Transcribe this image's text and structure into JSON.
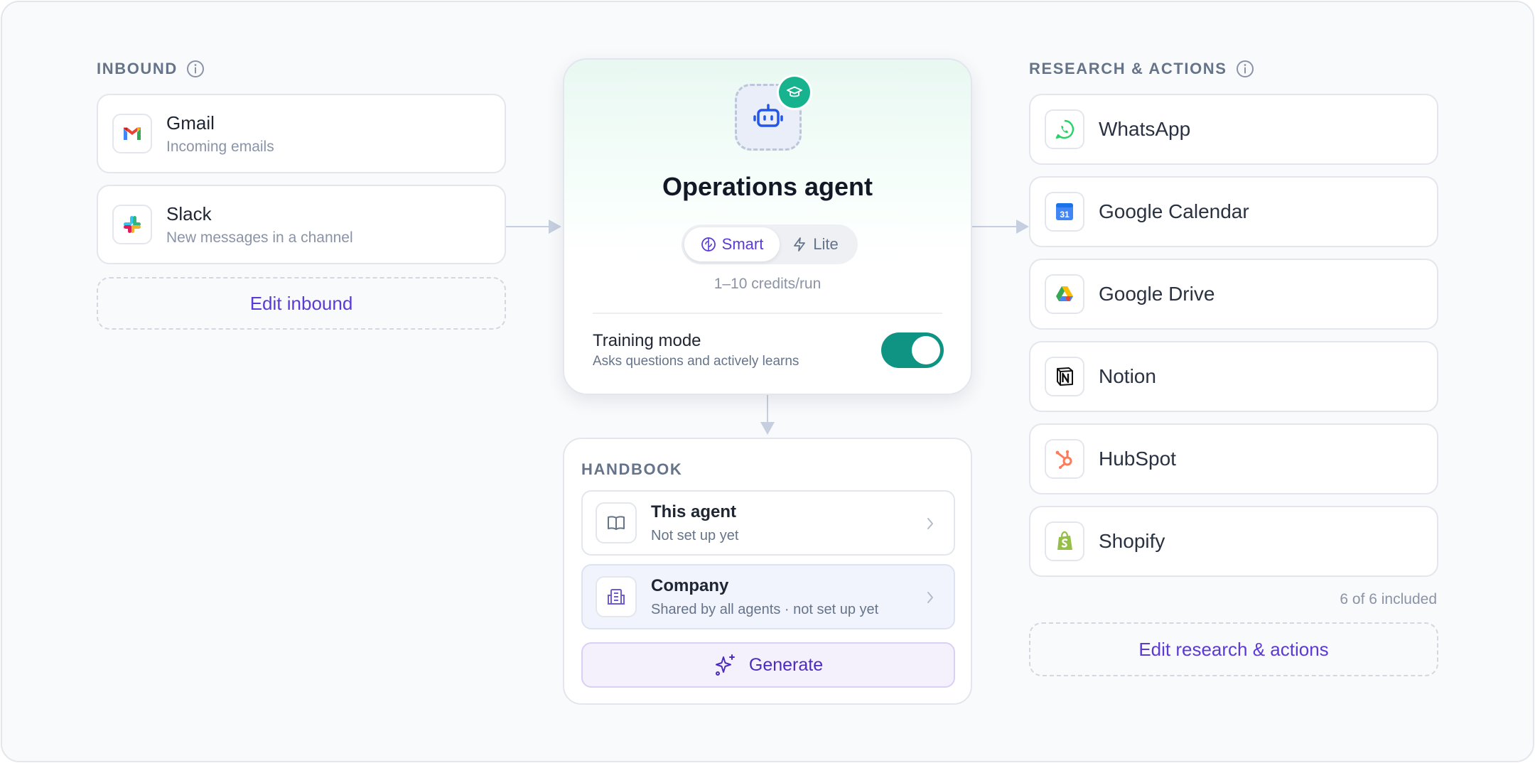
{
  "inbound": {
    "header": "INBOUND",
    "items": [
      {
        "title": "Gmail",
        "subtitle": "Incoming emails",
        "icon": "gmail-icon"
      },
      {
        "title": "Slack",
        "subtitle": "New messages in a channel",
        "icon": "slack-icon"
      }
    ],
    "edit_label": "Edit inbound"
  },
  "agent": {
    "name": "Operations agent",
    "modes": [
      {
        "label": "Smart",
        "icon": "brain-icon",
        "selected": true
      },
      {
        "label": "Lite",
        "icon": "bolt-icon",
        "selected": false
      }
    ],
    "credits": "1–10 credits/run",
    "training_mode": {
      "title": "Training mode",
      "subtitle": "Asks questions and actively learns",
      "enabled": true
    }
  },
  "handbook": {
    "header": "HANDBOOK",
    "items": [
      {
        "title": "This agent",
        "subtitle": "Not set up yet",
        "icon": "book-icon"
      },
      {
        "title": "Company",
        "subtitle": "Shared by all agents · not set up yet",
        "icon": "building-icon"
      }
    ],
    "generate_label": "Generate"
  },
  "research": {
    "header": "RESEARCH & ACTIONS",
    "items": [
      {
        "title": "WhatsApp",
        "icon": "whatsapp-icon"
      },
      {
        "title": "Google Calendar",
        "icon": "google-calendar-icon",
        "icon_text": "31"
      },
      {
        "title": "Google Drive",
        "icon": "google-drive-icon"
      },
      {
        "title": "Notion",
        "icon": "notion-icon"
      },
      {
        "title": "HubSpot",
        "icon": "hubspot-icon"
      },
      {
        "title": "Shopify",
        "icon": "shopify-icon"
      }
    ],
    "count_text": "6 of 6 included",
    "edit_label": "Edit research & actions"
  },
  "colors": {
    "accent_purple": "#5b3ad6",
    "toggle_teal": "#0f9483",
    "badge_green": "#17b38e"
  }
}
